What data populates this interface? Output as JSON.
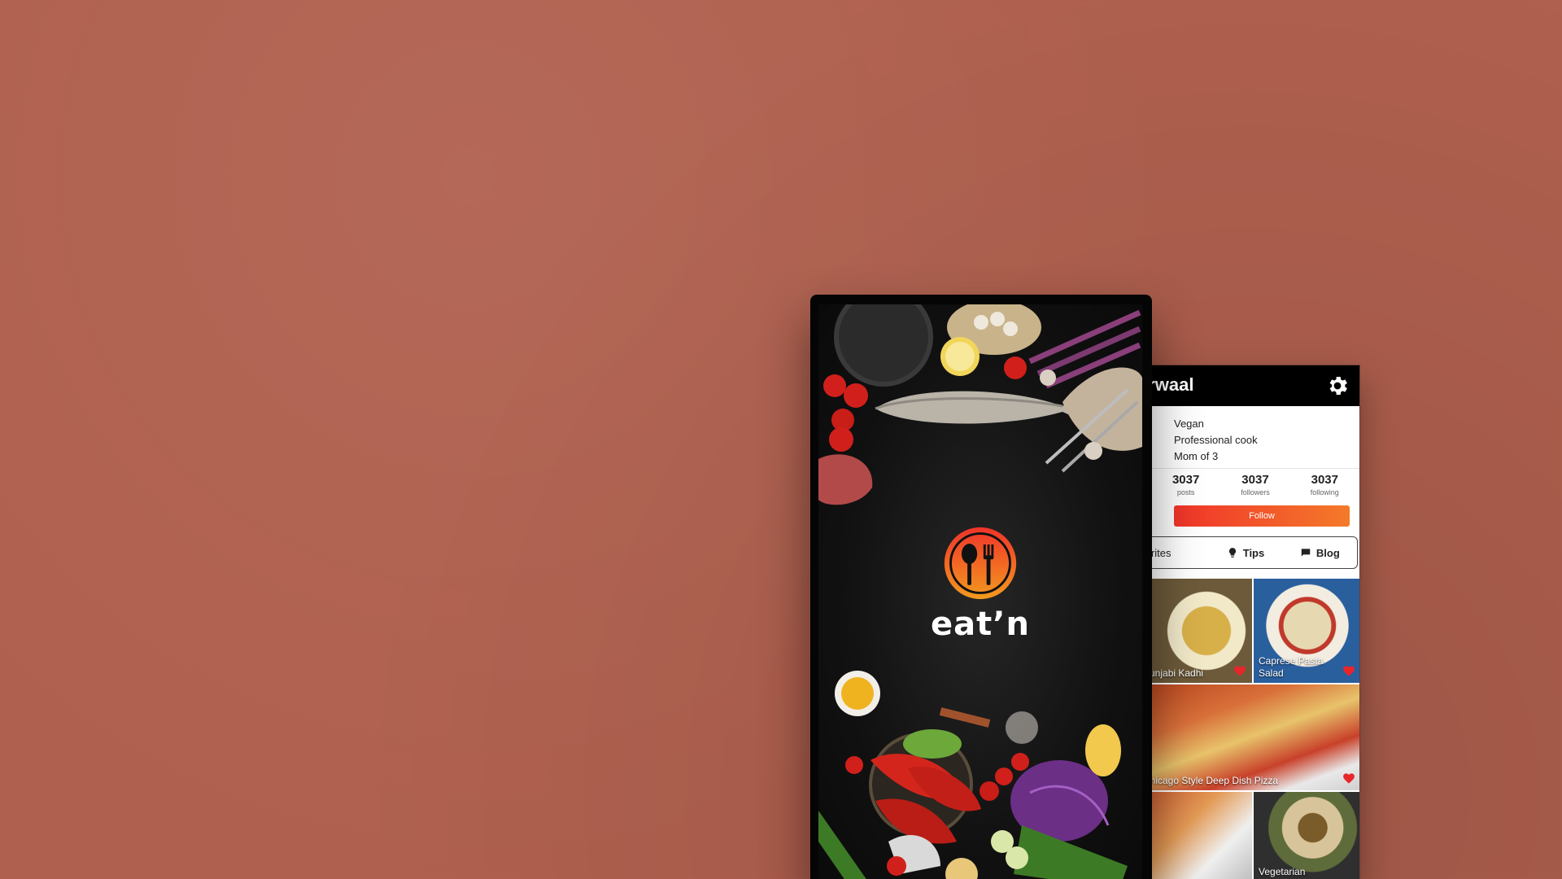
{
  "app": {
    "name": "eat’n"
  },
  "profile": {
    "username_fragment": "erwaal",
    "bio": [
      "Vegan",
      "Professional cook",
      "Mom of 3"
    ],
    "stats": [
      {
        "value": "3037",
        "label": "posts"
      },
      {
        "value": "3037",
        "label": "followers"
      },
      {
        "value": "3037",
        "label": "following"
      }
    ],
    "follow_label": "Follow",
    "tabs": [
      {
        "label": "avorites",
        "icon": "favorites-icon"
      },
      {
        "label": "Tips",
        "icon": "lightbulb-icon"
      },
      {
        "label": "Blog",
        "icon": "chat-icon"
      }
    ],
    "recipes": [
      {
        "title": "Punjabi Kadhi",
        "favorited": true
      },
      {
        "title": "Caprese Pasta Salad",
        "favorited": true
      },
      {
        "title": "Chicago Style Deep Dish Pizza",
        "favorited": true
      },
      {
        "title": "",
        "favorited": false
      },
      {
        "title": "Vegetarian",
        "favorited": false
      }
    ]
  },
  "colors": {
    "background": "#b0604e",
    "accent_start": "#f0342a",
    "accent_end": "#f47a2a",
    "heart": "#e8262a",
    "logo_orange": "#f39a1e"
  }
}
